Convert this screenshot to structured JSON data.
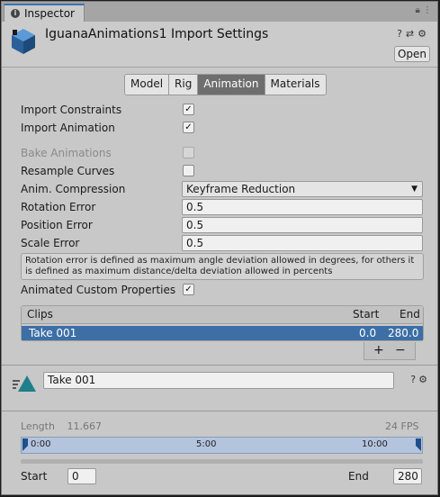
{
  "window": {
    "tab_label": "Inspector"
  },
  "header": {
    "title": "IguanaAnimations1 Import Settings",
    "open_label": "Open",
    "icons": [
      "help-icon",
      "preset-icon",
      "settings-icon"
    ]
  },
  "tabs": [
    {
      "label": "Model",
      "active": false
    },
    {
      "label": "Rig",
      "active": false
    },
    {
      "label": "Animation",
      "active": true
    },
    {
      "label": "Materials",
      "active": false
    }
  ],
  "settings": {
    "import_constraints": {
      "label": "Import Constraints",
      "checked": true
    },
    "import_animation": {
      "label": "Import Animation",
      "checked": true
    },
    "bake_animations": {
      "label": "Bake Animations",
      "checked": false,
      "disabled": true
    },
    "resample_curves": {
      "label": "Resample Curves",
      "checked": false
    },
    "anim_compression": {
      "label": "Anim. Compression",
      "value": "Keyframe Reduction"
    },
    "rotation_error": {
      "label": "Rotation Error",
      "value": "0.5"
    },
    "position_error": {
      "label": "Position Error",
      "value": "0.5"
    },
    "scale_error": {
      "label": "Scale Error",
      "value": "0.5"
    },
    "help_text": "Rotation error is defined as maximum angle deviation allowed in degrees, for others it is defined as maximum distance/delta deviation allowed in percents",
    "animated_custom_properties": {
      "label": "Animated Custom Properties",
      "checked": true
    }
  },
  "clips": {
    "headers": {
      "name": "Clips",
      "start": "Start",
      "end": "End"
    },
    "rows": [
      {
        "name": "Take 001",
        "start": "0.0",
        "end": "280.0"
      }
    ],
    "add_label": "+",
    "remove_label": "−"
  },
  "clip_editor": {
    "name": "Take 001",
    "length_label": "Length",
    "length_value": "11.667",
    "fps": "24 FPS",
    "timeline_ticks": [
      "0:00",
      "5:00",
      "10:00"
    ],
    "start_label": "Start",
    "start_value": "0",
    "end_label": "End",
    "end_value": "280"
  },
  "colors": {
    "accent": "#3d6fa6",
    "active_tab": "#6e6e6e",
    "timeline": "#b4c4dd"
  }
}
